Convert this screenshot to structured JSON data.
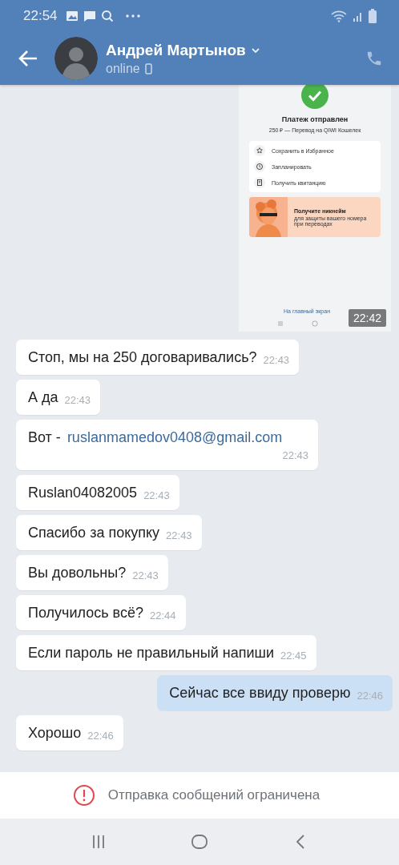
{
  "status_bar": {
    "time": "22:54"
  },
  "header": {
    "name": "Андрей Мартынов",
    "status": "online"
  },
  "messages": [
    {
      "kind": "screenshot",
      "time": "22:42",
      "screenshot": {
        "title": "Платеж отправлен",
        "subtitle": "250 ₽ — Перевод на QIWI Кошелек",
        "actions": [
          {
            "kind": "star",
            "label": "Сохранить в Избранное"
          },
          {
            "kind": "clock",
            "label": "Запланировать"
          },
          {
            "kind": "receipt",
            "label": "Получить квитанцию"
          }
        ],
        "promo": {
          "title": "Получите никнейм",
          "text": "для защиты вашего номера при переводах"
        },
        "link": "На главный экран"
      }
    },
    {
      "kind": "incoming",
      "text": "Стоп, мы на 250 договаривались?",
      "time": "22:43"
    },
    {
      "kind": "incoming",
      "text": "А да",
      "time": "22:43"
    },
    {
      "kind": "incoming",
      "text": "Вот -",
      "link": "ruslanmamedov0408@gmail.com",
      "time": "22:43"
    },
    {
      "kind": "incoming",
      "text": "Ruslan04082005",
      "time": "22:43"
    },
    {
      "kind": "incoming",
      "text": "Спасибо за покупку",
      "time": "22:43"
    },
    {
      "kind": "incoming",
      "text": "Вы довольны?",
      "time": "22:43"
    },
    {
      "kind": "incoming",
      "text": "Получилось всё?",
      "time": "22:44"
    },
    {
      "kind": "incoming",
      "text": "Если пароль не правильный напиши",
      "time": "22:45"
    },
    {
      "kind": "outgoing",
      "text": "Сейчас все ввиду проверю",
      "time": "22:46"
    },
    {
      "kind": "incoming",
      "text": "Хорошо",
      "time": "22:46"
    }
  ],
  "footer": {
    "notice": "Отправка сообщений ограничена"
  }
}
